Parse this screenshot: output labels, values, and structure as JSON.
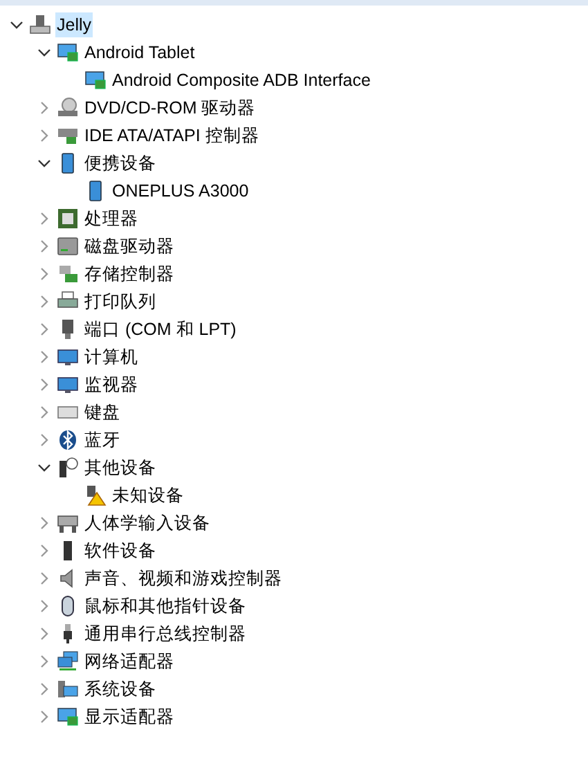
{
  "tree": [
    {
      "label": "Jelly",
      "selected": true,
      "expanded": true,
      "children": [
        {
          "label": "Android Tablet",
          "selected": false,
          "expanded": true,
          "children": [
            {
              "label": "Android Composite ADB Interface",
              "selected": false
            }
          ]
        },
        {
          "label": "DVD/CD-ROM 驱动器",
          "selected": false,
          "expanded": false
        },
        {
          "label": "IDE ATA/ATAPI 控制器",
          "selected": false,
          "expanded": false
        },
        {
          "label": "便携设备",
          "selected": false,
          "expanded": true,
          "children": [
            {
              "label": "ONEPLUS A3000",
              "selected": false
            }
          ]
        },
        {
          "label": "处理器",
          "selected": false,
          "expanded": false
        },
        {
          "label": "磁盘驱动器",
          "selected": false,
          "expanded": false
        },
        {
          "label": "存储控制器",
          "selected": false,
          "expanded": false
        },
        {
          "label": "打印队列",
          "selected": false,
          "expanded": false
        },
        {
          "label": "端口 (COM 和 LPT)",
          "selected": false,
          "expanded": false
        },
        {
          "label": "计算机",
          "selected": false,
          "expanded": false
        },
        {
          "label": "监视器",
          "selected": false,
          "expanded": false
        },
        {
          "label": "键盘",
          "selected": false,
          "expanded": false
        },
        {
          "label": "蓝牙",
          "selected": false,
          "expanded": false
        },
        {
          "label": "其他设备",
          "selected": false,
          "expanded": true,
          "children": [
            {
              "label": "未知设备",
              "selected": false
            }
          ]
        },
        {
          "label": "人体学输入设备",
          "selected": false,
          "expanded": false
        },
        {
          "label": "软件设备",
          "selected": false,
          "expanded": false
        },
        {
          "label": "声音、视频和游戏控制器",
          "selected": false,
          "expanded": false
        },
        {
          "label": "鼠标和其他指针设备",
          "selected": false,
          "expanded": false
        },
        {
          "label": "通用串行总线控制器",
          "selected": false,
          "expanded": false
        },
        {
          "label": "网络适配器",
          "selected": false,
          "expanded": false
        },
        {
          "label": "系统设备",
          "selected": false,
          "expanded": false
        },
        {
          "label": "显示适配器",
          "selected": false,
          "expanded": false
        }
      ]
    }
  ]
}
